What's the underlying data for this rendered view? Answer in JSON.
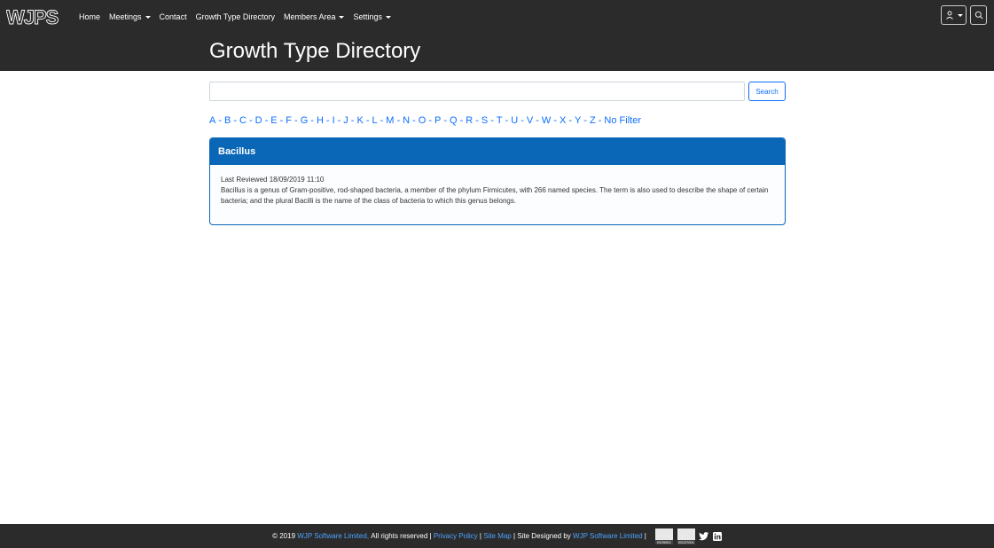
{
  "nav": {
    "logo_text": "WJPS",
    "items": [
      {
        "label": "Home",
        "has_caret": false
      },
      {
        "label": "Meetings",
        "has_caret": true
      },
      {
        "label": "Contact",
        "has_caret": false
      },
      {
        "label": "Growth Type Directory",
        "has_caret": false
      },
      {
        "label": "Members Area",
        "has_caret": true
      },
      {
        "label": "Settings",
        "has_caret": true
      }
    ],
    "user_icon": "user-icon",
    "search_icon": "search-icon"
  },
  "header": {
    "title": "Growth Type Directory"
  },
  "search": {
    "value": "",
    "placeholder": "",
    "button_label": "Search"
  },
  "alphabet": [
    "A",
    "B",
    "C",
    "D",
    "E",
    "F",
    "G",
    "H",
    "I",
    "J",
    "K",
    "L",
    "M",
    "N",
    "O",
    "P",
    "Q",
    "R",
    "S",
    "T",
    "U",
    "V",
    "W",
    "X",
    "Y",
    "Z",
    "No Filter"
  ],
  "card": {
    "title": "Bacillus",
    "reviewed": "Last Reviewed 18/09/2019 11:10",
    "description": "Bacillus is a genus of Gram-positive, rod-shaped bacteria, a member of the phylum Firmicutes, with 266 named species. The term is also used to describe the shape of certain bacteria; and the plural Bacilli is the name of the class of bacteria to which this genus belongs."
  },
  "footer": {
    "copyright": "© 2019",
    "company_link": "WJP Software Limited,",
    "rights": "All rights reserved |",
    "privacy_link": "Privacy Policy",
    "sep1": "|",
    "sitemap_link": "Site Map",
    "designed_by": "| Site Designed by",
    "designer_link": "WJP Software Limited",
    "sep2": "|",
    "badge1_label": "ISO9001",
    "badge2_label": "ISO27001",
    "twitter_icon": "twitter-icon",
    "linkedin_icon": "linkedin-icon"
  },
  "colors": {
    "nav_bg": "#2b2b2b",
    "accent": "#0a66b7",
    "link": "#0d6efd",
    "footer_link": "#4da3ff"
  }
}
